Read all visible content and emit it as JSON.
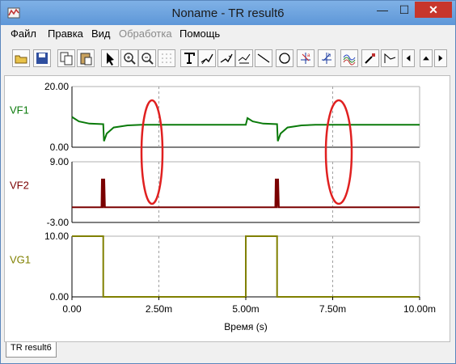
{
  "window": {
    "title": "Noname - TR result6",
    "minimize_glyph": "—",
    "maximize_glyph": "☐",
    "close_glyph": "✕"
  },
  "menu": [
    "Файл",
    "Правка",
    "Вид",
    "Обработка",
    "Помощь"
  ],
  "menu_disabled": [
    false,
    false,
    false,
    true,
    false
  ],
  "toolbar_icons": [
    "open-folder-icon",
    "save-icon",
    "copy-icon",
    "paste-icon",
    "pointer-icon",
    "zoom-in-icon",
    "zoom-out-icon",
    "grid-icon",
    "text-tool-icon",
    "cursor-a-icon",
    "cursor-b-icon",
    "cursor-measure-icon",
    "line-tool-icon",
    "circle-tool-icon",
    "cursor-a-marker-icon",
    "cursor-b-marker-icon",
    "add-curves-icon",
    "probe-icon",
    "flag-icon",
    "scroll-left-icon",
    "scroll-up-icon",
    "scroll-right-icon"
  ],
  "tab": {
    "label": "TR result6"
  },
  "accent": {
    "vf1": "#0a7a0a",
    "vf2": "#7a0000",
    "vg1": "#808000",
    "ellipse": "#e02020"
  },
  "chart_data": [
    {
      "type": "line",
      "series": [
        {
          "name": "VF1",
          "x": [
            0,
            0.05,
            0.2,
            0.5,
            0.9,
            0.92,
            1.0,
            1.2,
            1.6,
            2.0,
            2.5,
            5.0,
            5.05,
            5.2,
            5.5,
            5.9,
            5.92,
            6.0,
            6.2,
            6.6,
            7.0,
            10.0
          ],
          "values": [
            10.0,
            9.6,
            8.5,
            7.8,
            7.6,
            2.0,
            4.5,
            6.5,
            7.2,
            7.4,
            7.4,
            7.4,
            9.6,
            8.5,
            7.8,
            7.6,
            2.0,
            4.5,
            6.5,
            7.2,
            7.4,
            7.4
          ]
        }
      ],
      "ylim": [
        0.0,
        20.0
      ],
      "ytick_labels": [
        "0.00",
        "20.00"
      ],
      "xlim": [
        0,
        10
      ]
    },
    {
      "type": "line",
      "series": [
        {
          "name": "VF2",
          "x": [
            0,
            0.85,
            0.86,
            0.88,
            0.89,
            0.9,
            0.92,
            0.93,
            0.95,
            0.96,
            5.0,
            5.85,
            5.86,
            5.88,
            5.89,
            5.9,
            5.92,
            5.93,
            5.95,
            5.96,
            10.0
          ],
          "values": [
            0.0,
            0.0,
            5.5,
            5.5,
            0.0,
            0.0,
            5.5,
            5.5,
            0.0,
            0.0,
            0.0,
            0.0,
            5.5,
            5.5,
            0.0,
            0.0,
            5.5,
            5.5,
            0.0,
            0.0,
            0.0
          ]
        }
      ],
      "ylim": [
        -3.0,
        9.0
      ],
      "ytick_labels": [
        "-3.00",
        "9.00"
      ],
      "xlim": [
        0,
        10
      ]
    },
    {
      "type": "line",
      "series": [
        {
          "name": "VG1",
          "x": [
            0,
            0.9,
            0.9,
            5.0,
            5.0,
            5.9,
            5.9,
            10.0
          ],
          "values": [
            10,
            10,
            0,
            0,
            10,
            10,
            0,
            0
          ]
        }
      ],
      "ylim": [
        0.0,
        10.0
      ],
      "ytick_labels": [
        "0.00",
        "10.00"
      ],
      "xlim": [
        0,
        10
      ],
      "xticks": [
        0,
        2.5,
        5,
        7.5,
        10
      ],
      "xtick_labels": [
        "0.00",
        "2.50m",
        "5.00m",
        "7.50m",
        "10.00m"
      ],
      "xlabel": "Время (s)"
    }
  ]
}
